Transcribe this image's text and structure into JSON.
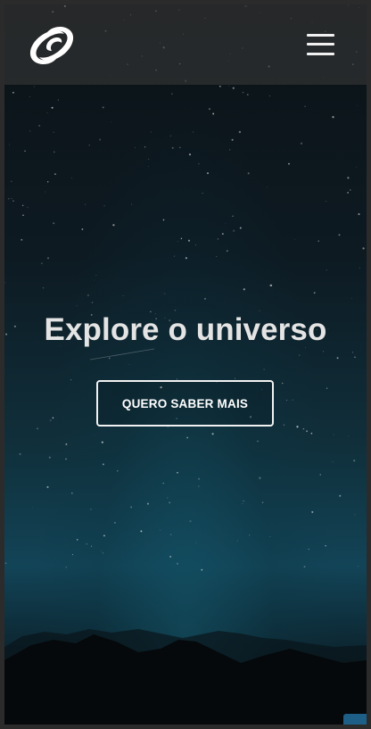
{
  "header": {
    "logo_icon": "swirl-logo-icon",
    "menu_icon": "hamburger-menu-icon"
  },
  "hero": {
    "title": "Explore o universo",
    "cta_label": "QUERO SABER MAIS"
  },
  "colors": {
    "header_bg": "#373737",
    "text": "#e4e4e4",
    "sky_top": "#0c1216",
    "sky_horizon": "#124457",
    "corner_widget": "#1d5f86"
  }
}
